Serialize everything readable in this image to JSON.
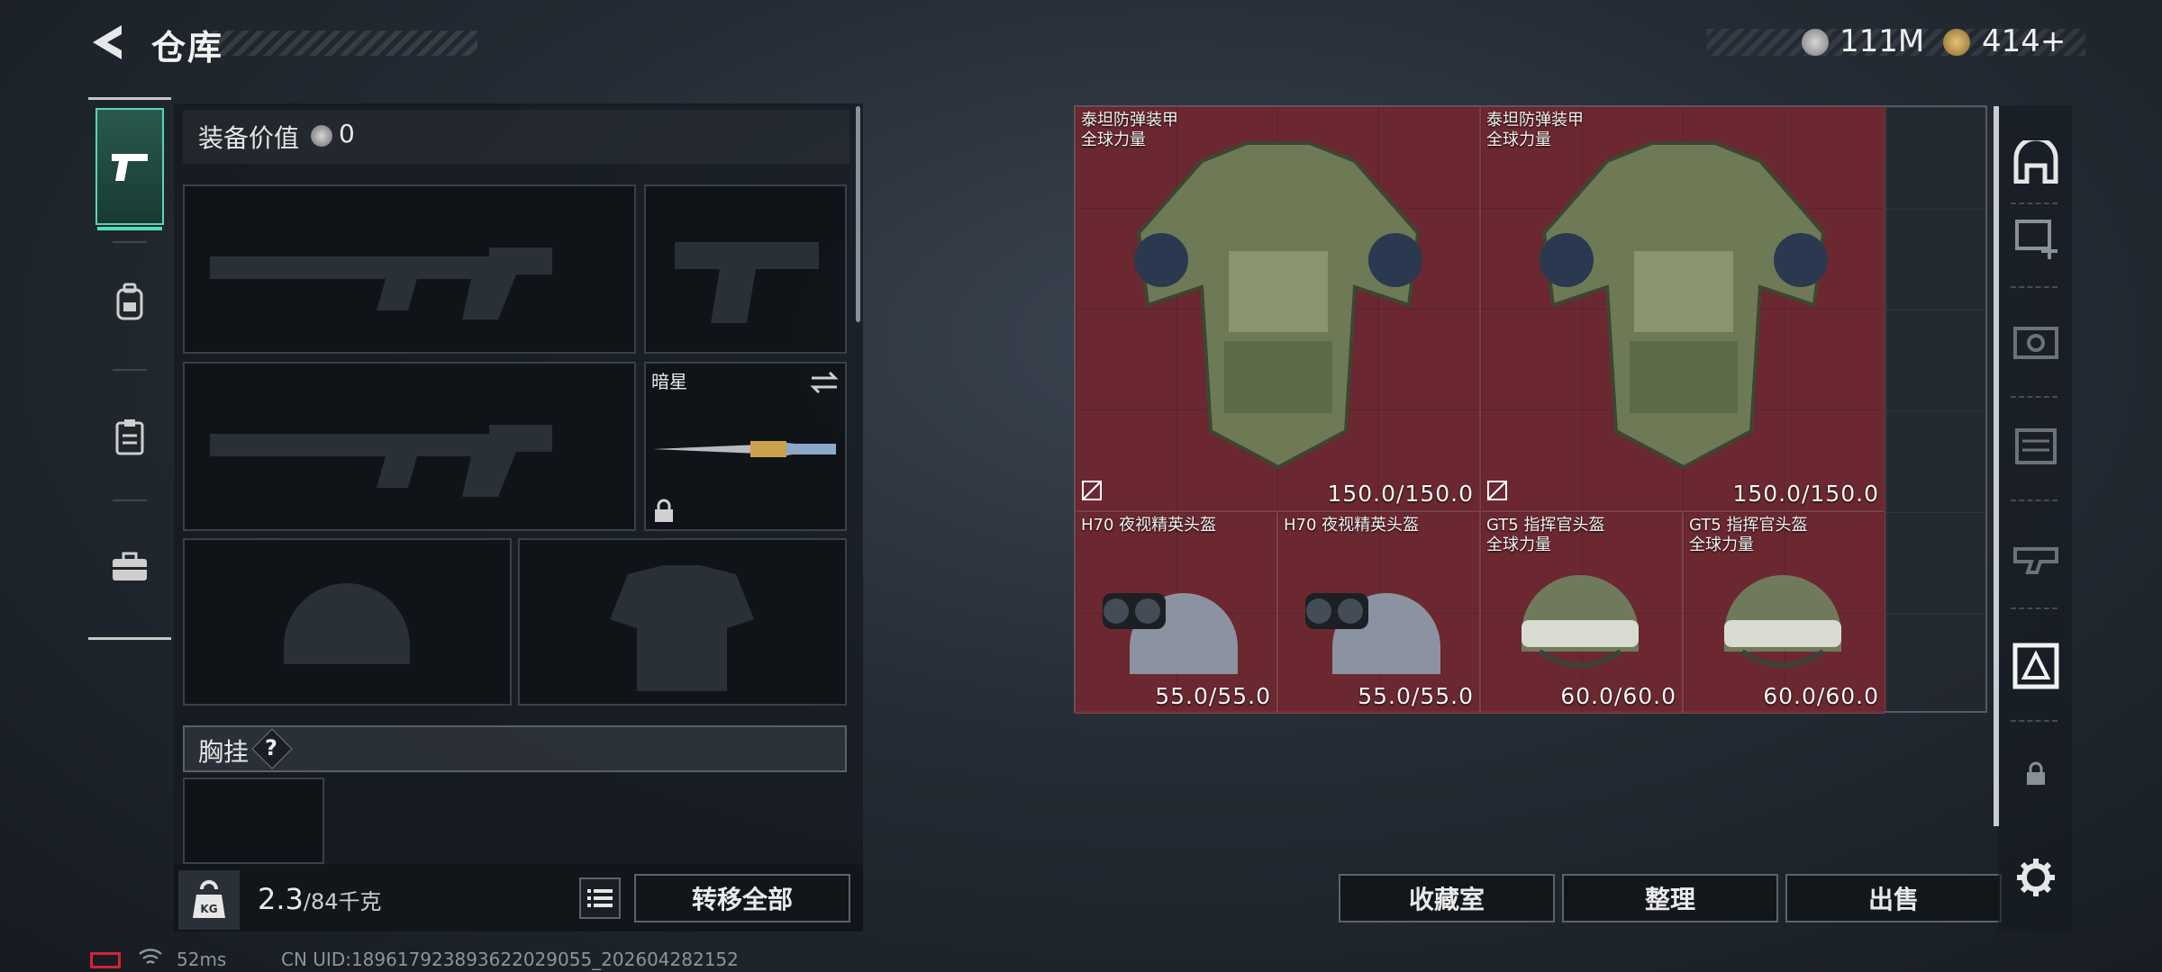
{
  "header": {
    "title": "仓库",
    "currency1": {
      "icon": "silver-coin-icon",
      "value": "111M"
    },
    "currency2": {
      "icon": "gold-coin-icon",
      "value": "414+"
    }
  },
  "tabs": [
    {
      "name": "pistol-icon",
      "active": true
    },
    {
      "name": "backpack-icon",
      "active": false
    },
    {
      "name": "clipboard-icon",
      "active": false
    },
    {
      "name": "toolbox-icon",
      "active": false
    }
  ],
  "loadout": {
    "value_label": "装备价值",
    "value": "0",
    "melee_name": "暗星",
    "chest_label": "胸挂",
    "chest_help": "?"
  },
  "weight": {
    "current": "2.3",
    "max": "/84千克",
    "icon_text": "KG"
  },
  "buttons": {
    "transfer_all": "转移全部",
    "collection": "收藏室",
    "organize": "整理",
    "sell": "出售"
  },
  "items": [
    {
      "name1": "泰坦防弹装甲",
      "name2": "全球力量",
      "durability": "150.0/150.0",
      "kind": "armor"
    },
    {
      "name1": "泰坦防弹装甲",
      "name2": "全球力量",
      "durability": "150.0/150.0",
      "kind": "armor"
    },
    {
      "name1": "H70 夜视精英头盔",
      "name2": "",
      "durability": "55.0/55.0",
      "kind": "nv-helmet"
    },
    {
      "name1": "H70 夜视精英头盔",
      "name2": "",
      "durability": "55.0/55.0",
      "kind": "nv-helmet"
    },
    {
      "name1": "GT5 指挥官头盔",
      "name2": "全球力量",
      "durability": "60.0/60.0",
      "kind": "helmet"
    },
    {
      "name1": "GT5 指挥官头盔",
      "name2": "全球力量",
      "durability": "60.0/60.0",
      "kind": "helmet"
    }
  ],
  "status": {
    "ping": "52ms",
    "uid": "CN UID:18961792389362202905​5_202604282152"
  },
  "colors": {
    "accent": "#4ee0b5",
    "item_bg": "#7a2a32"
  }
}
